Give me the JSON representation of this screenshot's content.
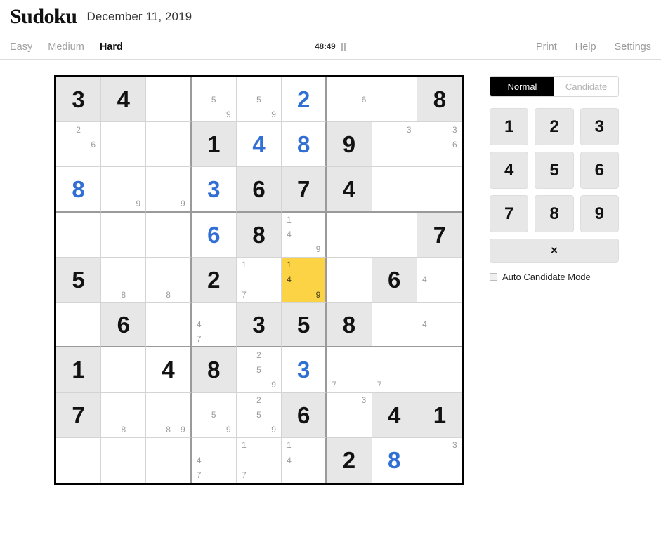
{
  "masthead": {
    "brand": "Sudoku",
    "date": "December 11, 2019"
  },
  "toolbar": {
    "difficulties": [
      {
        "label": "Easy",
        "active": false
      },
      {
        "label": "Medium",
        "active": false
      },
      {
        "label": "Hard",
        "active": true
      }
    ],
    "timer": "48:49",
    "pause_icon": "pause-icon",
    "links": [
      {
        "label": "Print"
      },
      {
        "label": "Help"
      },
      {
        "label": "Settings"
      }
    ]
  },
  "panel": {
    "modes": [
      {
        "label": "Normal",
        "active": true
      },
      {
        "label": "Candidate",
        "active": false
      }
    ],
    "numbers": [
      "1",
      "2",
      "3",
      "4",
      "5",
      "6",
      "7",
      "8",
      "9"
    ],
    "erase_label": "×",
    "auto_candidate_label": "Auto Candidate Mode",
    "auto_candidate_checked": false
  },
  "colors": {
    "given_cell_bg": "#e7e7e7",
    "selected_cell_bg": "#fcd344",
    "user_value": "#316fd4",
    "given_value": "#121212",
    "candidate": "#9b9b9b",
    "grid_border": "#000000",
    "box_border": "#9a9a9a"
  },
  "board": {
    "selected_cell": {
      "row": 5,
      "col": 6
    },
    "cells": [
      [
        {
          "value": "3",
          "type": "given"
        },
        {
          "value": "4",
          "type": "given"
        },
        {
          "value": null
        },
        {
          "value": null,
          "candidates": [
            5,
            9
          ]
        },
        {
          "value": null,
          "candidates": [
            5,
            9
          ]
        },
        {
          "value": "2",
          "type": "user"
        },
        {
          "value": null,
          "candidates": [
            6
          ]
        },
        {
          "value": null
        },
        {
          "value": "8",
          "type": "given"
        }
      ],
      [
        {
          "value": null,
          "candidates": [
            2,
            6
          ]
        },
        {
          "value": null
        },
        {
          "value": null
        },
        {
          "value": "1",
          "type": "given"
        },
        {
          "value": "4",
          "type": "user"
        },
        {
          "value": "8",
          "type": "user"
        },
        {
          "value": "9",
          "type": "given"
        },
        {
          "value": null,
          "candidates": [
            3
          ]
        },
        {
          "value": null,
          "candidates": [
            3,
            6
          ]
        }
      ],
      [
        {
          "value": "8",
          "type": "user"
        },
        {
          "value": null,
          "candidates": [
            9
          ]
        },
        {
          "value": null,
          "candidates": [
            9
          ]
        },
        {
          "value": "3",
          "type": "user"
        },
        {
          "value": "6",
          "type": "given"
        },
        {
          "value": "7",
          "type": "given"
        },
        {
          "value": "4",
          "type": "given"
        },
        {
          "value": null
        },
        {
          "value": null
        }
      ],
      [
        {
          "value": null
        },
        {
          "value": null
        },
        {
          "value": null
        },
        {
          "value": "6",
          "type": "user"
        },
        {
          "value": "8",
          "type": "given"
        },
        {
          "value": null,
          "candidates": [
            1,
            4,
            9
          ]
        },
        {
          "value": null
        },
        {
          "value": null
        },
        {
          "value": "7",
          "type": "given"
        }
      ],
      [
        {
          "value": "5",
          "type": "given"
        },
        {
          "value": null,
          "candidates": [
            8
          ]
        },
        {
          "value": null,
          "candidates": [
            8
          ]
        },
        {
          "value": "2",
          "type": "given"
        },
        {
          "value": null,
          "candidates": [
            1,
            7
          ]
        },
        {
          "value": null,
          "candidates": [
            1,
            4,
            9
          ],
          "selected": true
        },
        {
          "value": null
        },
        {
          "value": "6",
          "type": "given"
        },
        {
          "value": null,
          "candidates": [
            4
          ]
        }
      ],
      [
        {
          "value": null
        },
        {
          "value": "6",
          "type": "given"
        },
        {
          "value": null
        },
        {
          "value": null,
          "candidates": [
            4,
            7
          ]
        },
        {
          "value": "3",
          "type": "given"
        },
        {
          "value": "5",
          "type": "given"
        },
        {
          "value": "8",
          "type": "given"
        },
        {
          "value": null
        },
        {
          "value": null,
          "candidates": [
            4
          ]
        }
      ],
      [
        {
          "value": "1",
          "type": "given"
        },
        {
          "value": null
        },
        {
          "value": "4",
          "type": "plain"
        },
        {
          "value": "8",
          "type": "given"
        },
        {
          "value": null,
          "candidates": [
            2,
            5,
            9
          ]
        },
        {
          "value": "3",
          "type": "user"
        },
        {
          "value": null,
          "candidates": [
            7
          ]
        },
        {
          "value": null,
          "candidates": [
            7
          ]
        },
        {
          "value": null
        }
      ],
      [
        {
          "value": "7",
          "type": "given"
        },
        {
          "value": null,
          "candidates": [
            8
          ]
        },
        {
          "value": null,
          "candidates": [
            8,
            9
          ]
        },
        {
          "value": null,
          "candidates": [
            5,
            9
          ]
        },
        {
          "value": null,
          "candidates": [
            2,
            5,
            9
          ]
        },
        {
          "value": "6",
          "type": "given"
        },
        {
          "value": null,
          "candidates": [
            3
          ]
        },
        {
          "value": "4",
          "type": "given"
        },
        {
          "value": "1",
          "type": "given"
        }
      ],
      [
        {
          "value": null
        },
        {
          "value": null
        },
        {
          "value": null
        },
        {
          "value": null,
          "candidates": [
            4,
            7
          ]
        },
        {
          "value": null,
          "candidates": [
            1,
            7
          ]
        },
        {
          "value": null,
          "candidates": [
            1,
            4
          ]
        },
        {
          "value": "2",
          "type": "given"
        },
        {
          "value": "8",
          "type": "user"
        },
        {
          "value": null,
          "candidates": [
            3
          ]
        }
      ]
    ]
  }
}
